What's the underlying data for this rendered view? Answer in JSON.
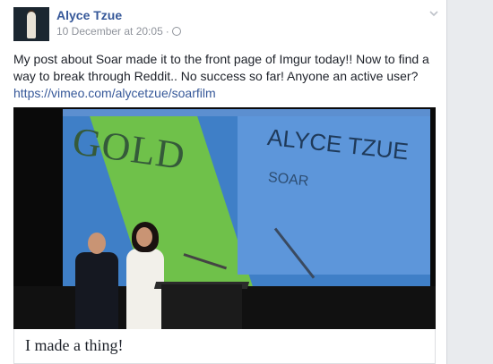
{
  "post": {
    "author": "Alyce Tzue",
    "timestamp": "10 December at 20:05",
    "separator": "·",
    "privacy_icon": "globe-icon",
    "menu_icon": "chevron-down-icon",
    "text_line1": "My post about Soar made it to the front page of Imgur today!! Now to find a way to break through Reddit.. No success so far! Anyone an active user?",
    "link": "https://vimeo.com/alycetzue/soarfilm"
  },
  "media": {
    "screen_gold": "GOLD",
    "screen_name": "ALYCE TZUE",
    "screen_sub": "SOAR"
  },
  "link_preview": {
    "title": "I made a thing!"
  },
  "colors": {
    "link": "#365899",
    "text": "#1d2129",
    "meta": "#90949c"
  }
}
